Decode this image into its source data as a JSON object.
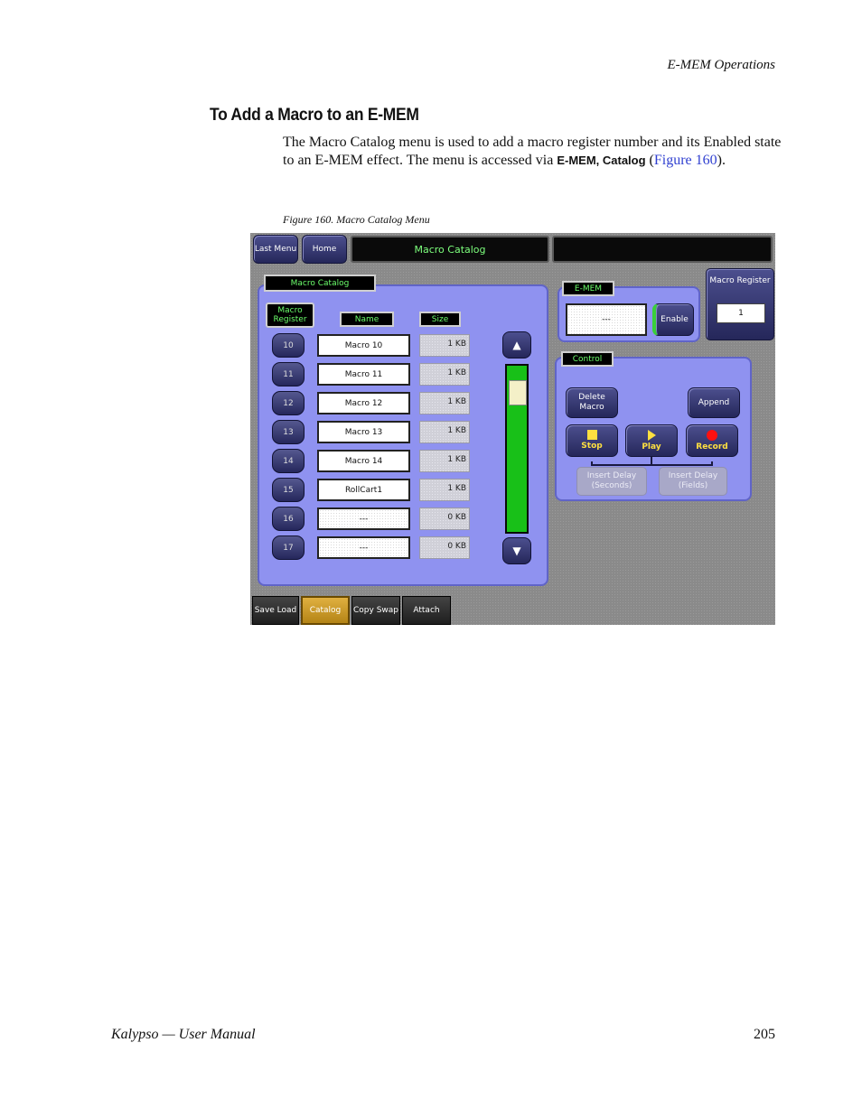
{
  "header": {
    "running_head": "E-MEM Operations"
  },
  "section": {
    "heading": "To Add a Macro to an E-MEM",
    "para_1": "The Macro Catalog menu is used to add a macro register number and its Enabled state to an E-MEM effect. The menu is accessed via ",
    "para_ui": "E-MEM, Catalog",
    "para_2": " (",
    "para_link": "Figure 160",
    "para_3": ")."
  },
  "figure": {
    "caption": "Figure 160.  Macro Catalog Menu"
  },
  "screen": {
    "top": {
      "last_menu": "Last Menu",
      "home": "Home",
      "title": "Macro Catalog",
      "blank": ""
    },
    "catalog_panel": {
      "label": "Macro Catalog",
      "col_register": "Macro Register",
      "col_name": "Name",
      "col_size": "Size",
      "rows": [
        {
          "reg": "10",
          "name": "Macro 10",
          "size": "1 KB"
        },
        {
          "reg": "11",
          "name": "Macro 11",
          "size": "1 KB"
        },
        {
          "reg": "12",
          "name": "Macro 12",
          "size": "1 KB"
        },
        {
          "reg": "13",
          "name": "Macro 13",
          "size": "1 KB"
        },
        {
          "reg": "14",
          "name": "Macro 14",
          "size": "1 KB"
        },
        {
          "reg": "15",
          "name": "RollCart1",
          "size": "1 KB"
        },
        {
          "reg": "16",
          "name": "---",
          "size": "0 KB"
        },
        {
          "reg": "17",
          "name": "---",
          "size": "0 KB"
        }
      ],
      "scroll_up": "▲",
      "scroll_down": "▼"
    },
    "emem_panel": {
      "label": "E-MEM",
      "value": "---",
      "enable": "Enable"
    },
    "macro_register": {
      "label": "Macro Register",
      "value": "1"
    },
    "control_panel": {
      "label": "Control",
      "delete_macro": "Delete Macro",
      "append": "Append",
      "stop": "Stop",
      "play": "Play",
      "record": "Record",
      "insert_delay_seconds": "Insert Delay (Seconds)",
      "insert_delay_fields": "Insert Delay (Fields)"
    },
    "tabs": {
      "save_load": "Save Load",
      "catalog": "Catalog",
      "copy_swap": "Copy Swap",
      "attach": "Attach"
    }
  },
  "footer": {
    "left": "Kalypso — User Manual",
    "page": "205"
  },
  "colors": {
    "panel": "#8f92f0",
    "label_text": "#6cff6c",
    "active_tab": "#d8a830",
    "record": "#ff1010",
    "stop_play": "#ffe040",
    "scroll_green": "#18c018"
  }
}
